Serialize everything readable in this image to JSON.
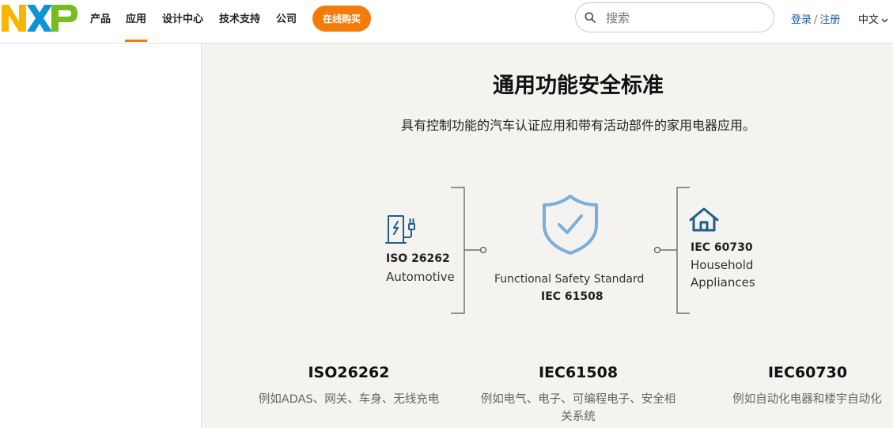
{
  "header": {
    "logo_text": "NXP",
    "nav": [
      "产品",
      "应用",
      "设计中心",
      "技术支持",
      "公司"
    ],
    "active_nav": "应用",
    "buy_label": "在线购买",
    "search_placeholder": "搜索",
    "login_label": "登录",
    "register_label": "注册",
    "login_separator": "/",
    "language": "中文"
  },
  "section": {
    "title": "通用功能安全标准",
    "subtitle": "具有控制功能的汽车认证应用和带有活动部件的家用电器应用。"
  },
  "diagram": {
    "left_std": "ISO 26262",
    "left_label": "Automotive",
    "center_label": "Functional Safety Standard",
    "center_std": "IEC 61508",
    "right_std": "IEC 60730",
    "right_label_1": "Household",
    "right_label_2": "Appliances"
  },
  "columns": [
    {
      "title": "ISO26262",
      "desc": "例如ADAS、网关、车身、无线充电"
    },
    {
      "title": "IEC61508",
      "desc": "例如电气、电子、可编程电子、安全相关系统"
    },
    {
      "title": "IEC60730",
      "desc": "例如自动化电器和楼宇自动化"
    }
  ],
  "colors": {
    "accent": "#f47b0b",
    "brand_blue": "#1a5ca8",
    "icon_blue": "#1f5f8b",
    "shield_blue": "#7aaedc"
  },
  "icons": [
    "search-icon",
    "ev-charger-icon",
    "shield-check-icon",
    "house-icon",
    "chevron-down-icon"
  ]
}
